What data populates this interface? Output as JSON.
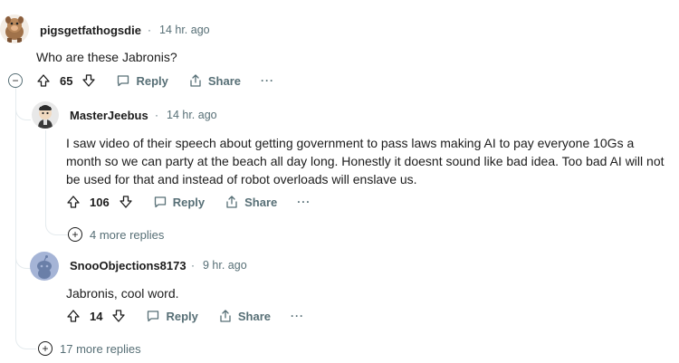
{
  "comments": [
    {
      "username": "pigsgetfathogsdie",
      "time": "14 hr. ago",
      "body": "Who are these Jabronis?",
      "score": "65",
      "reply_label": "Reply",
      "share_label": "Share",
      "more_label": "···"
    },
    {
      "username": "MasterJeebus",
      "time": "14 hr. ago",
      "body": "I saw video of their speech about getting government to pass laws making AI to pay everyone 10Gs a month so we can party at the beach all day long. Honestly it doesnt sound like bad idea. Too bad AI will not be used for that and instead of robot overloads will enslave us.",
      "score": "106",
      "reply_label": "Reply",
      "share_label": "Share",
      "more_label": "···",
      "more_replies": "4 more replies"
    },
    {
      "username": "SnooObjections8173",
      "time": "9 hr. ago",
      "body": "Jabronis, cool word.",
      "score": "14",
      "reply_label": "Reply",
      "share_label": "Share",
      "more_label": "···"
    }
  ],
  "thread_more_replies": "17 more replies",
  "separator": "·",
  "collapse_symbol": "−",
  "plus_symbol": "+",
  "colors": {
    "meta": "#576f76",
    "text": "#1c1c1c",
    "thread_line": "#e5ebee",
    "snoo_bg": "#a5b4d6"
  }
}
